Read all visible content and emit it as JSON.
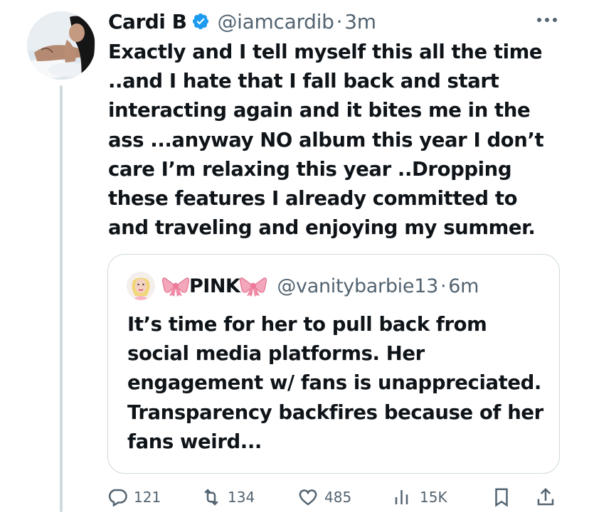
{
  "tweet": {
    "author": {
      "display_name": "Cardi B",
      "verified": true,
      "handle": "@iamcardib",
      "time": "3m",
      "avatar_icon": "profile-photo"
    },
    "separator": "·",
    "more_icon": "more-horizontal-icon",
    "text": "Exactly and I tell myself this all the time ..and I hate that I fall back and start interacting again and it bites me in the ass ...anyway NO album this year I don’t care I’m relaxing this year ..Dropping these features I already committed to and traveling and enjoying my summer.",
    "accent_color": "#1d9bf0"
  },
  "quote": {
    "author": {
      "display_name": "PINK",
      "name_emoji": "ribbon-bow",
      "handle": "@vanitybarbie13",
      "time": "6m",
      "avatar_icon": "profile-photo"
    },
    "separator": "·",
    "text": "It’s time for her to pull back from social media platforms. Her engagement w/ fans is unappreciated. Transparency backfires because of her fans weird..."
  },
  "actions": [
    {
      "icon": "reply-icon",
      "count": "121"
    },
    {
      "icon": "retweet-icon",
      "count": "134"
    },
    {
      "icon": "like-icon",
      "count": "485"
    },
    {
      "icon": "views-icon",
      "count": "15K"
    },
    {
      "icon": "bookmark-icon",
      "count": ""
    },
    {
      "icon": "share-icon",
      "count": ""
    }
  ]
}
